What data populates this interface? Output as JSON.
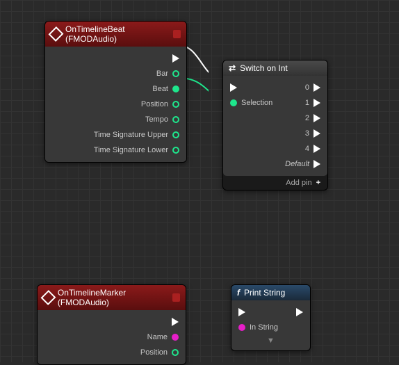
{
  "nodes": {
    "beat": {
      "title": "OnTimelineBeat (FMODAudio)",
      "pins": [
        "Bar",
        "Beat",
        "Position",
        "Tempo",
        "Time Signature Upper",
        "Time Signature Lower"
      ]
    },
    "switch": {
      "title": "Switch on Int",
      "selection": "Selection",
      "outs": [
        "0",
        "1",
        "2",
        "3",
        "4"
      ],
      "default": "Default",
      "addpin": "Add pin"
    },
    "marker": {
      "title": "OnTimelineMarker (FMODAudio)",
      "pins": [
        "Name",
        "Position"
      ]
    },
    "print": {
      "title": "Print String",
      "instring": "In String"
    }
  }
}
